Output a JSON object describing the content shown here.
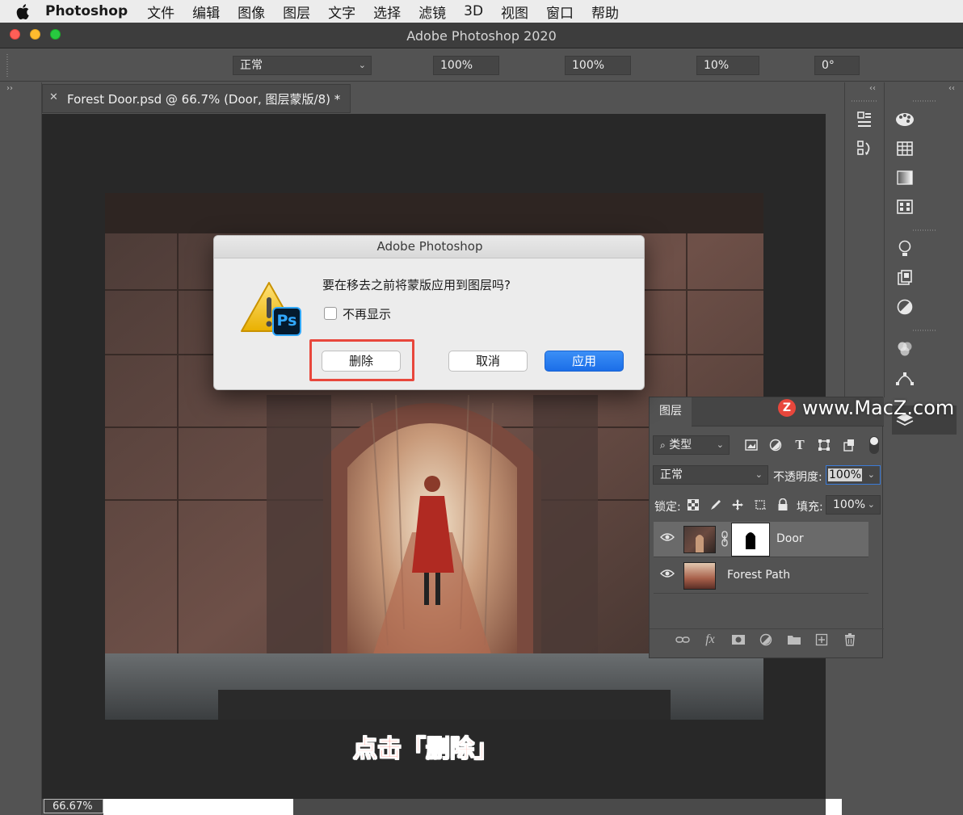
{
  "menubar": {
    "app": "Photoshop",
    "items": [
      "文件",
      "编辑",
      "图像",
      "图层",
      "文字",
      "选择",
      "滤镜",
      "3D",
      "视图",
      "窗口",
      "帮助"
    ]
  },
  "window": {
    "title": "Adobe Photoshop 2020"
  },
  "options": {
    "mode": "正常",
    "opacity": "100%",
    "flow": "100%",
    "smoothing": "10%",
    "angle": "0°"
  },
  "document": {
    "tab_title": "Forest Door.psd @ 66.7% (Door, 图层蒙版/8) *",
    "zoom": "66.67%"
  },
  "dialog": {
    "title": "Adobe Photoshop",
    "message": "要在移去之前将蒙版应用到图层吗?",
    "checkbox_label": "不再显示",
    "delete_label": "删除",
    "cancel_label": "取消",
    "apply_label": "应用",
    "icon_badge": "Ps"
  },
  "layers_panel": {
    "tab": "图层",
    "filter_label": "类型",
    "blend_mode": "正常",
    "opacity_label": "不透明度:",
    "opacity_value": "100%",
    "lock_label": "锁定:",
    "fill_label": "填充:",
    "fill_value": "100%",
    "layers": [
      {
        "name": "Door"
      },
      {
        "name": "Forest Path"
      }
    ]
  },
  "caption": "点击「删除」",
  "watermark": {
    "badge": "Z",
    "text": "www.MacZ.com"
  },
  "colors": {
    "accent_red": "#e8473c",
    "primary_button": "#1b6ee8"
  }
}
